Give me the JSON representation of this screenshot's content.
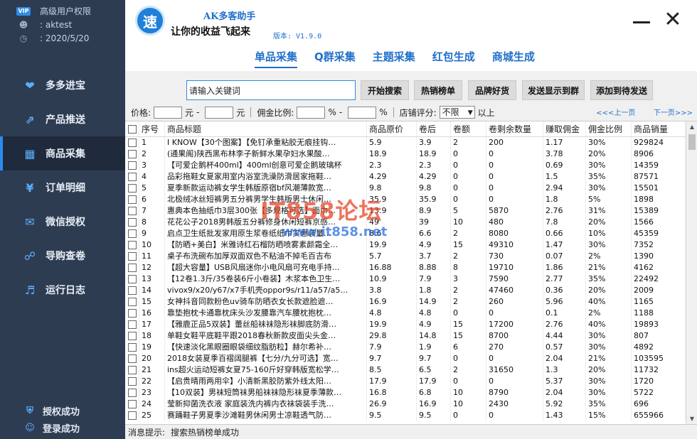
{
  "user": {
    "level": "高级用户权限",
    "name": "aktest",
    "date": "2020/5/20",
    "vip_badge": "VIP"
  },
  "nav": [
    {
      "label": "多多进宝",
      "icon": "heart-icon"
    },
    {
      "label": "产品推送",
      "icon": "share-icon"
    },
    {
      "label": "商品采集",
      "icon": "search-grid-icon"
    },
    {
      "label": "订单明细",
      "icon": "order-icon"
    },
    {
      "label": "微信授权",
      "icon": "wechat-icon"
    },
    {
      "label": "导购查卷",
      "icon": "guide-icon"
    },
    {
      "label": "运行日志",
      "icon": "log-icon"
    }
  ],
  "nav_active": "商品采集",
  "status_items": [
    {
      "label": "授权成功",
      "icon": "shield-icon"
    },
    {
      "label": "登录成功",
      "icon": "user-icon"
    }
  ],
  "header": {
    "logo_char": "速",
    "app_name": "AK多客助手",
    "slogan": "让你的收益飞起来",
    "version": "版本: V1.9.0"
  },
  "tabs": [
    "单品采集",
    "Q群采集",
    "主题采集",
    "红包生成",
    "商城生成"
  ],
  "active_tab": "单品采集",
  "toolbar": {
    "search_placeholder": "请输入关键词",
    "buttons": [
      "开始搜索",
      "热销榜单",
      "品牌好货",
      "发送显示到群",
      "添加到待发送"
    ]
  },
  "filter": {
    "price_label": "价格:",
    "yuan": "元",
    "dash": "-",
    "comm_label": "佣金比例:",
    "pct": "%",
    "shop_label": "店铺评分:",
    "shop_value": "不限",
    "above": "以上",
    "prev": "<<<上一页",
    "next": "下一页>>>"
  },
  "table": {
    "headers": [
      "序号",
      "商品标题",
      "商品原价",
      "卷后",
      "卷额",
      "卷剩余数量",
      "赚取佣金",
      "佣金比例",
      "商品销量"
    ],
    "rows": [
      [
        "1",
        "I KNOW【30个图案】【免钉承重粘胶无痕挂钩…",
        "5.9",
        "3.9",
        "2",
        "200",
        "1.17",
        "30%",
        "929824"
      ],
      [
        "2",
        "(通果阁)陕西黑布林李子新鲜水果孕妇水果酸…",
        "18.9",
        "18.9",
        "0",
        "0",
        "3.78",
        "20%",
        "8906"
      ],
      [
        "3",
        "【可爱企鹅杯400ml】400ml创意可爱企鹅玻璃杯",
        "2.3",
        "2.3",
        "0",
        "0",
        "0.69",
        "30%",
        "14359"
      ],
      [
        "4",
        "品彩拖鞋女夏家用室内浴室洗澡防滑居家拖鞋…",
        "4.29",
        "4.29",
        "0",
        "0",
        "1.5",
        "35%",
        "87571"
      ],
      [
        "5",
        "夏季新款运动裤女学生韩版原宿bf风潮薄款宽…",
        "9.8",
        "9.8",
        "0",
        "0",
        "2.94",
        "30%",
        "15501"
      ],
      [
        "6",
        "北极绒冰丝短裤男五分裤男学生韩版男士休闲…",
        "35.9",
        "35.9",
        "0",
        "0",
        "1.8",
        "5%",
        "1898"
      ],
      [
        "7",
        "惠典本色抽纸巾3层300张【多规格可选】面巾…",
        "13.9",
        "8.9",
        "5",
        "5870",
        "2.76",
        "31%",
        "15389"
      ],
      [
        "8",
        "花花公子2018男韩版五分裤修身休闲短裤京感…",
        "49",
        "39",
        "10",
        "480",
        "7.8",
        "20%",
        "1566"
      ],
      [
        "9",
        "启点卫生纸批发家用原生浆卷纸纸巾实惠装量…",
        "8.6",
        "6.6",
        "2",
        "8080",
        "0.66",
        "10%",
        "45359"
      ],
      [
        "10",
        "【防晒+美白】米雅诗红石榴防晒喷雾素颜霜全…",
        "19.9",
        "4.9",
        "15",
        "49310",
        "1.47",
        "30%",
        "7352"
      ],
      [
        "11",
        "桌子布洗碗布加厚双面双色不粘油不掉毛百吉布",
        "5.7",
        "3.7",
        "2",
        "730",
        "0.07",
        "2%",
        "1390"
      ],
      [
        "12",
        "【超大容量】USB风扇迷你小电风扇可充电手持…",
        "16.88",
        "8.88",
        "8",
        "19710",
        "1.86",
        "21%",
        "4162"
      ],
      [
        "13",
        "【12卷1.3斤/35卷装6斤小卷装】木浆本色卫生…",
        "10.9",
        "7.9",
        "3",
        "7590",
        "2.77",
        "35%",
        "22492"
      ],
      [
        "14",
        "vivox9/x20/y67/x7手机壳oppor9s/r11/a57/a5…",
        "3.8",
        "1.8",
        "2",
        "47460",
        "0.36",
        "20%",
        "2009"
      ],
      [
        "15",
        "女神抖音同款粉色uv骑车防晒衣女长款遮脸遮…",
        "16.9",
        "14.9",
        "2",
        "260",
        "5.96",
        "40%",
        "1165"
      ],
      [
        "16",
        "靠垫抱枕卡通靠枕床头沙发腰靠汽车腰枕抱枕…",
        "4.8",
        "4.8",
        "0",
        "0",
        "0.1",
        "2%",
        "1188"
      ],
      [
        "17",
        "【雅鹿正品5双装】蕾丝船袜袜隐形袜脚底防滑…",
        "19.9",
        "4.9",
        "15",
        "17200",
        "2.76",
        "40%",
        "19893"
      ],
      [
        "18",
        "单鞋女鞋平底鞋平跟2018春秋新款皮面尖头金…",
        "29.8",
        "14.8",
        "15",
        "8700",
        "4.44",
        "30%",
        "807"
      ],
      [
        "19",
        "【快速淡化黑眼圈眼袋细纹脂肪粒】赫尔希补…",
        "7.9",
        "1.9",
        "6",
        "270",
        "0.57",
        "30%",
        "4892"
      ],
      [
        "20",
        "2018女装夏季百褶阔腿裤【七分/九分可选】宽…",
        "9.7",
        "9.7",
        "0",
        "0",
        "2.04",
        "21%",
        "103595"
      ],
      [
        "21",
        "ins超火运动短裤女夏75-160斤好穿韩版宽松学…",
        "8.5",
        "6.5",
        "2",
        "31650",
        "1.3",
        "20%",
        "11732"
      ],
      [
        "22",
        "【启贵晴雨两用伞】小清新黑胶防紫外线太阳…",
        "17.9",
        "17.9",
        "0",
        "0",
        "5.37",
        "30%",
        "1720"
      ],
      [
        "23",
        "【10双装】男袜短筒袜男船袜袜隐形袜夏季薄款…",
        "16.8",
        "6.8",
        "10",
        "8790",
        "2.04",
        "30%",
        "5722"
      ],
      [
        "24",
        "莹新抑菌洗衣液 家庭装洗内裤内衣袜袋装手洗…",
        "26.9",
        "16.9",
        "10",
        "2430",
        "5.92",
        "35%",
        "696"
      ],
      [
        "25",
        "赛踊鞋子男夏季沙滩鞋男休闲男士凉鞋透气防…",
        "9.5",
        "9.5",
        "0",
        "0",
        "1.43",
        "15%",
        "655966"
      ]
    ]
  },
  "watermark": {
    "main": "IT858论坛",
    "url": "www.it858.net"
  },
  "statusbar": {
    "label": "消息提示:",
    "message": "搜索热销榜单成功"
  }
}
